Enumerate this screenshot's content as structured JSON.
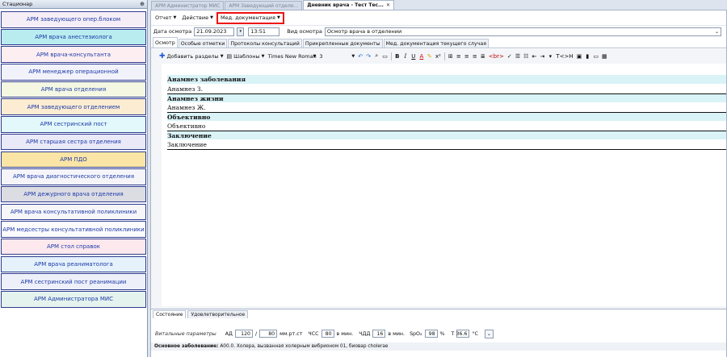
{
  "sidebar": {
    "title": "Стационар",
    "pin_icon": "pin-icon",
    "items": [
      {
        "label": "АРМ заведующего опер.блоком",
        "color": "#f6eef6"
      },
      {
        "label": "АРМ врача анестезиолога",
        "color": "#b8ecef"
      },
      {
        "label": "АРМ врача-консультанта",
        "color": "#fdeef2"
      },
      {
        "label": "АРМ менеджер  операционной",
        "color": "#f2f2fa"
      },
      {
        "label": "АРМ врача отделения",
        "color": "#f4f7e2"
      },
      {
        "label": "АРМ заведующего отделением",
        "color": "#fbecd2"
      },
      {
        "label": "АРМ сестринский пост",
        "color": "#e2f8fa"
      },
      {
        "label": "АРМ старшая сестра отделения",
        "color": "#e9e9f8"
      },
      {
        "label": "АРМ ПДО",
        "color": "#fbe5a6"
      },
      {
        "label": "АРМ врача диагностического отделения",
        "color": "#f5f5f9"
      },
      {
        "label": "АРМ дежурного врача отделения",
        "color": "#dcdce3"
      },
      {
        "label": "АРМ врача консультативной поликлиники",
        "color": "#f6f6f9"
      },
      {
        "label": "АРМ медсестры консультативной поликлиники",
        "color": "#fbfbfd"
      },
      {
        "label": "АРМ стол справок",
        "color": "#fde8ee"
      },
      {
        "label": "АРМ врача реаниматолога",
        "color": "#e5f1fb"
      },
      {
        "label": "АРМ сестринский пост реанимации",
        "color": "#eef0f9"
      },
      {
        "label": "АРМ Администратора МИС",
        "color": "#e5f3ee"
      }
    ]
  },
  "window_tabs": [
    {
      "label": "АРМ Администратор МИС",
      "active": false,
      "closable": false
    },
    {
      "label": "АРМ Заведующий отделе...",
      "active": false,
      "closable": false
    },
    {
      "label": "Дневник врача - Тест Тес...",
      "active": true,
      "closable": true
    }
  ],
  "menubar": {
    "report": "Отчет",
    "action": "Действие",
    "med_docs": "Мед. документация"
  },
  "exam": {
    "date_label": "Дата осмотра",
    "date_value": "21.09.2023",
    "time_value": "13:51",
    "type_label": "Вид осмотра",
    "type_value": "Осмотр врача в отделении"
  },
  "doc_tabs": [
    "Осмотр",
    "Особые отметки",
    "Протоколы консультаций",
    "Прикрепленные документы",
    "Мед. документация текущего случая"
  ],
  "toolbar": {
    "add_sections": "Добавить разделы",
    "templates": "Шаблоны",
    "font_name": "Times New Roman",
    "font_size": "3"
  },
  "document": {
    "sections": [
      {
        "title": "Анамнез заболевания",
        "body": "Анамнез З."
      },
      {
        "title": "Анамнез жизни",
        "body": "Анамнез Ж."
      },
      {
        "title": "Объективно",
        "body": "Объективно"
      },
      {
        "title": "Заключение",
        "body": "Заключение"
      }
    ]
  },
  "bottom": {
    "tabs": [
      "Состояние",
      "Удовлетворительное"
    ],
    "vitals_label": "Витальные параметры",
    "ad_label": "АД",
    "ad_sys": "120",
    "ad_slash": "/",
    "ad_dia": "80",
    "ad_unit": "мм.рт.ст",
    "hr_label": "ЧСС",
    "hr_value": "80",
    "hr_unit": "в мин.",
    "rr_label": "ЧДД",
    "rr_value": "16",
    "rr_unit": "в мин.",
    "spo2_label": "SpO₂",
    "spo2_value": "98",
    "spo2_unit": "%",
    "t_label": "Т",
    "t_value": "36.6",
    "t_unit": "°С",
    "diagnosis_label": "Основное заболевание:",
    "diagnosis_value": "A00.0. Холера, вызванная холерным вибрионом 01, биовар cholerae"
  },
  "colors": {
    "highlight_box": "#e11111",
    "section_bg": "#d9f3f7",
    "sidebar_border": "#2e3c8f"
  }
}
